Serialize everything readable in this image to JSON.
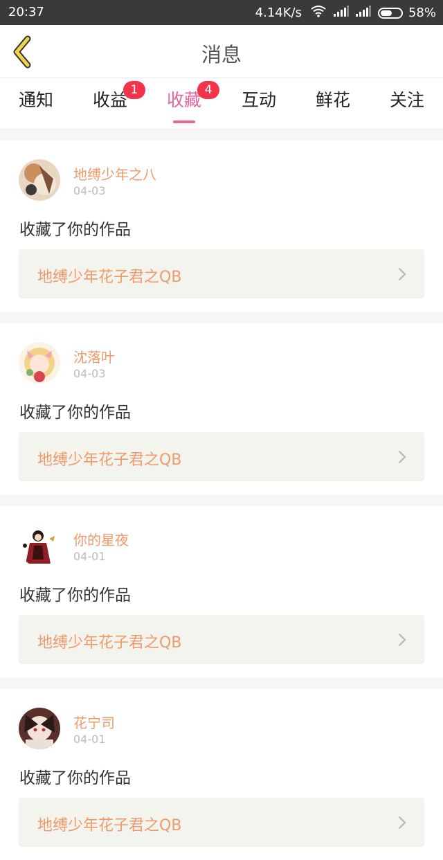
{
  "status_bar": {
    "time": "20:37",
    "net_speed": "4.14K/s",
    "battery": "58%",
    "battery_level": 0.58,
    "icons": [
      "wifi-icon",
      "signal-icon",
      "signal-icon",
      "battery-icon"
    ]
  },
  "header": {
    "title": "消息",
    "back_icon": "chevron-left-icon",
    "accent_color": "#f2d44a"
  },
  "tabs": [
    {
      "label": "通知"
    },
    {
      "label": "收益",
      "badge": "1"
    },
    {
      "label": "收藏",
      "badge": "4",
      "active": true
    },
    {
      "label": "互动"
    },
    {
      "label": "鲜花"
    },
    {
      "label": "关注"
    }
  ],
  "colors": {
    "active_tab": "#e4669c",
    "badge": "#f1344a",
    "username": "#ef9a6a",
    "work_link_bg": "#f4f4ef"
  },
  "feed": [
    {
      "username": "地缚少年之八",
      "date": "04-03",
      "action": "收藏了你的作品",
      "work_title": "地缚少年花子君之QB"
    },
    {
      "username": "沈落叶",
      "date": "04-03",
      "action": "收藏了你的作品",
      "work_title": "地缚少年花子君之QB"
    },
    {
      "username": "你的星夜",
      "date": "04-01",
      "action": "收藏了你的作品",
      "work_title": "地缚少年花子君之QB"
    },
    {
      "username": "花宁司",
      "date": "04-01",
      "action": "收藏了你的作品",
      "work_title": "地缚少年花子君之QB"
    }
  ]
}
